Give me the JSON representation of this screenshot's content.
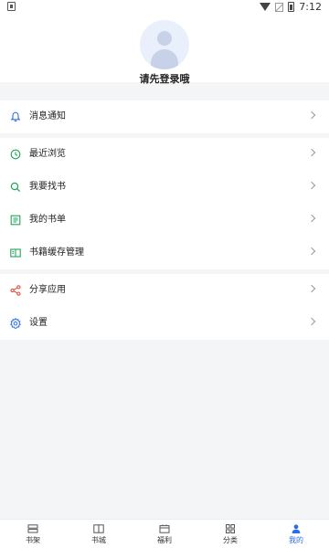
{
  "status_bar": {
    "time": "7:12"
  },
  "profile": {
    "login_prompt": "请先登录哦"
  },
  "menu_groups": [
    {
      "items": [
        {
          "label": "消息通知",
          "icon": "bell-icon",
          "icon_color": "#2b6de6"
        }
      ]
    },
    {
      "items": [
        {
          "label": "最近浏览",
          "icon": "clock-icon",
          "icon_color": "#22a35a"
        },
        {
          "label": "我要找书",
          "icon": "search-icon",
          "icon_color": "#22a35a"
        },
        {
          "label": "我的书单",
          "icon": "list-icon",
          "icon_color": "#22a35a"
        },
        {
          "label": "书籍缓存管理",
          "icon": "book-open-icon",
          "icon_color": "#22a35a"
        }
      ]
    },
    {
      "items": [
        {
          "label": "分享应用",
          "icon": "share-icon",
          "icon_color": "#e0503c"
        },
        {
          "label": "设置",
          "icon": "gear-icon",
          "icon_color": "#2b6de6"
        }
      ]
    }
  ],
  "bottom_nav": {
    "items": [
      {
        "label": "书架",
        "icon": "bookshelf-icon",
        "active": false
      },
      {
        "label": "书城",
        "icon": "book-icon",
        "active": false
      },
      {
        "label": "福利",
        "icon": "gift-icon",
        "active": false
      },
      {
        "label": "分类",
        "icon": "grid-icon",
        "active": false
      },
      {
        "label": "我的",
        "icon": "user-icon",
        "active": true
      }
    ],
    "active_color": "#2b6de6",
    "inactive_color": "#555555"
  }
}
